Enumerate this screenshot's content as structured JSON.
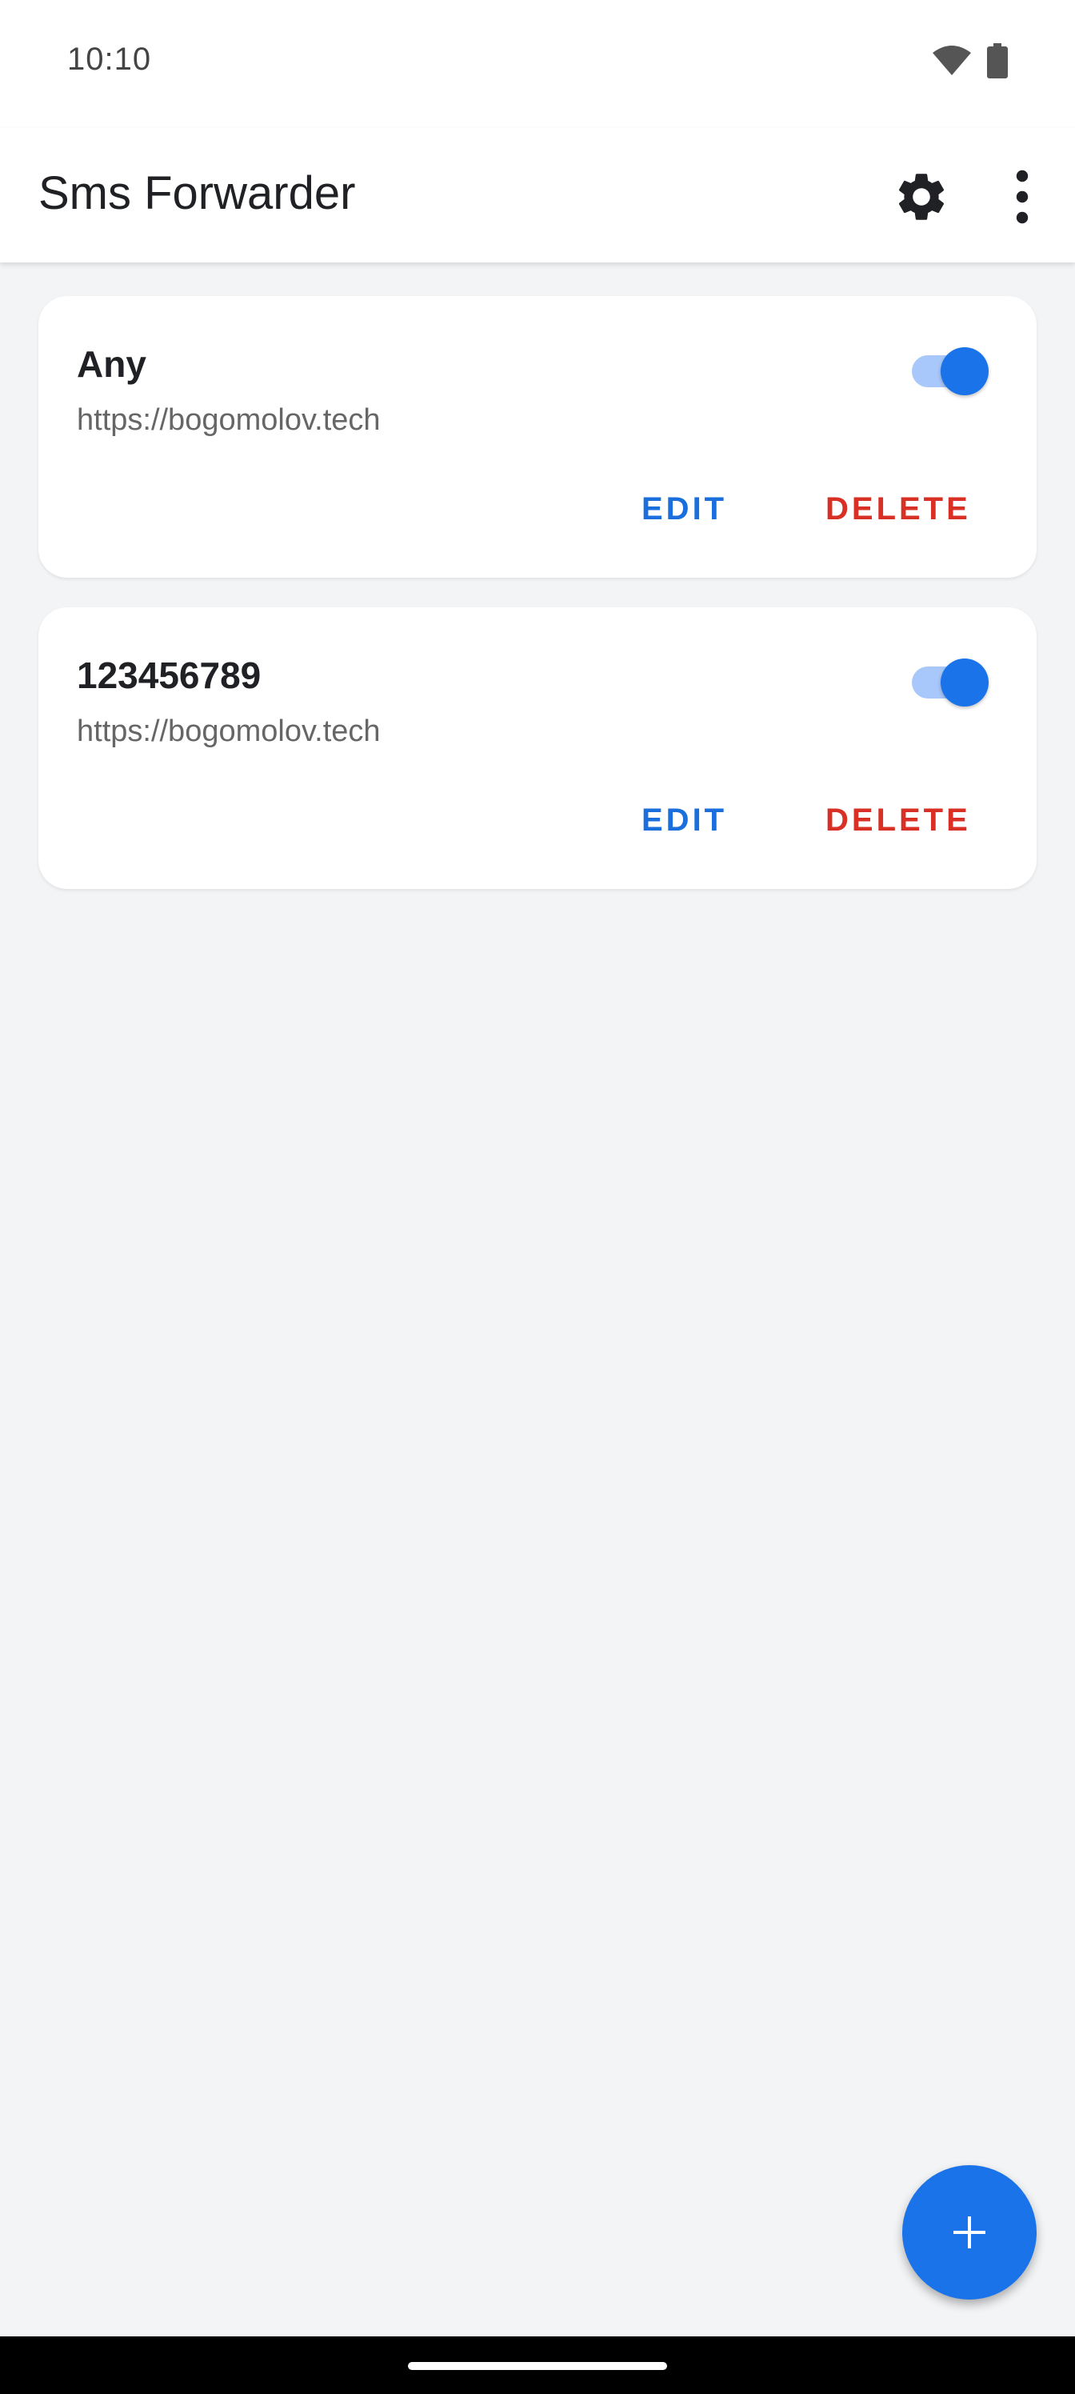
{
  "status_bar": {
    "time": "10:10",
    "icons": [
      "wifi-icon",
      "battery-icon"
    ]
  },
  "app_bar": {
    "title": "Sms Forwarder",
    "settings_icon": "gear-icon",
    "more_icon": "more-vert-icon"
  },
  "rules": [
    {
      "title": "Any",
      "url": "https://bogomolov.tech",
      "enabled": true,
      "edit_label": "EDIT",
      "delete_label": "DELETE"
    },
    {
      "title": "123456789",
      "url": "https://bogomolov.tech",
      "enabled": true,
      "edit_label": "EDIT",
      "delete_label": "DELETE"
    }
  ],
  "fab": {
    "icon": "plus-icon"
  },
  "colors": {
    "accent": "#1a73e8",
    "delete": "#d93025",
    "background": "#f3f4f6"
  }
}
